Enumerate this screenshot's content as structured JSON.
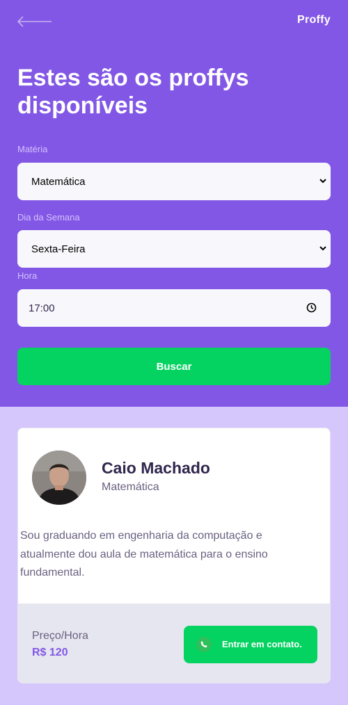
{
  "header": {
    "logo": "Proffy",
    "title": "Estes são os proffys disponíveis"
  },
  "filters": {
    "subject": {
      "label": "Matéria",
      "value": "Matemática"
    },
    "weekday": {
      "label": "Dia da Semana",
      "value": "Sexta-Feira"
    },
    "time": {
      "label": "Hora",
      "value": "17:00"
    },
    "search_label": "Buscar"
  },
  "teacher": {
    "name": "Caio Machado",
    "subject": "Matemática",
    "bio": "Sou graduando em engenharia da computação e atualmente dou aula de matemática para o ensino fundamental.",
    "price_label": "Preço/Hora",
    "price_value": "R$ 120",
    "contact_label": "Entrar em contato."
  },
  "colors": {
    "primary": "#8257e5",
    "secondary": "#04d361",
    "background": "#d5c6fb"
  }
}
